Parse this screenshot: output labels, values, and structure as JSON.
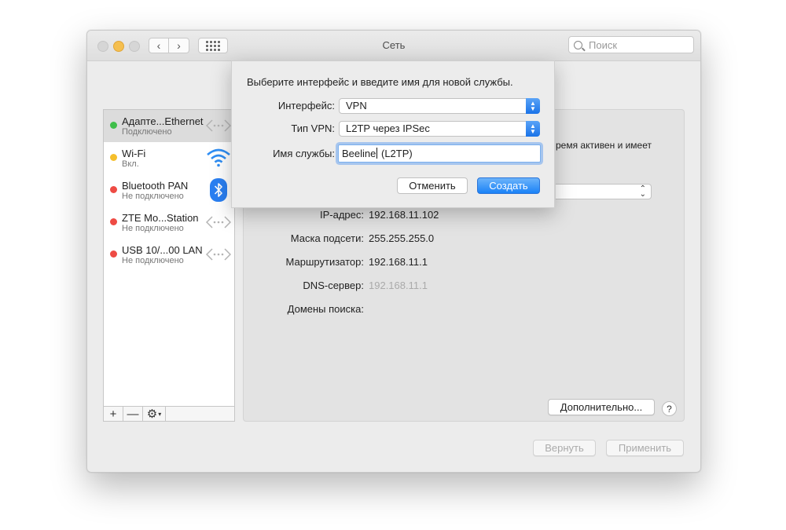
{
  "window": {
    "title": "Сеть",
    "search_placeholder": "Поиск"
  },
  "services": [
    {
      "name": "Адапте...Ethernet",
      "status": "Подключено",
      "dot_color": "#3fbe4a",
      "icon": "ethernet-icon",
      "selected": true
    },
    {
      "name": "Wi-Fi",
      "status": "Вкл.",
      "dot_color": "#f5bf2c",
      "icon": "wifi-icon"
    },
    {
      "name": "Bluetooth PAN",
      "status": "Не подключено",
      "dot_color": "#ee4b44",
      "icon": "bluetooth-icon"
    },
    {
      "name": "ZTE Mo...Station",
      "status": "Не подключено",
      "dot_color": "#ee4b44",
      "icon": "ethernet-icon"
    },
    {
      "name": "USB 10/...00 LAN",
      "status": "Не подключено",
      "dot_color": "#ee4b44",
      "icon": "ethernet-icon"
    }
  ],
  "sidebar_bottom": {
    "add": "+",
    "remove": "—",
    "gear": "⚙"
  },
  "detail": {
    "partial_text": "ремя активен и имеет",
    "fields": [
      {
        "label": "IP-адрес:",
        "value": "192.168.11.102"
      },
      {
        "label": "Маска подсети:",
        "value": "255.255.255.0"
      },
      {
        "label": "Маршрутизатор:",
        "value": "192.168.11.1"
      },
      {
        "label": "DNS-сервер:",
        "value": "192.168.11.1"
      },
      {
        "label": "Домены поиска:",
        "value": ""
      }
    ],
    "advanced_button": "Дополнительно...",
    "help": "?"
  },
  "footer": {
    "revert": "Вернуть",
    "apply": "Применить"
  },
  "sheet": {
    "prompt": "Выберите интерфейс и введите имя для новой службы.",
    "interface_label": "Интерфейс:",
    "interface_value": "VPN",
    "vpn_type_label": "Тип VPN:",
    "vpn_type_value": "L2TP через IPSec",
    "service_name_label": "Имя службы:",
    "service_name_before_caret": "Beeline",
    "service_name_after_caret": " (L2TP)",
    "cancel": "Отменить",
    "create": "Создать"
  }
}
